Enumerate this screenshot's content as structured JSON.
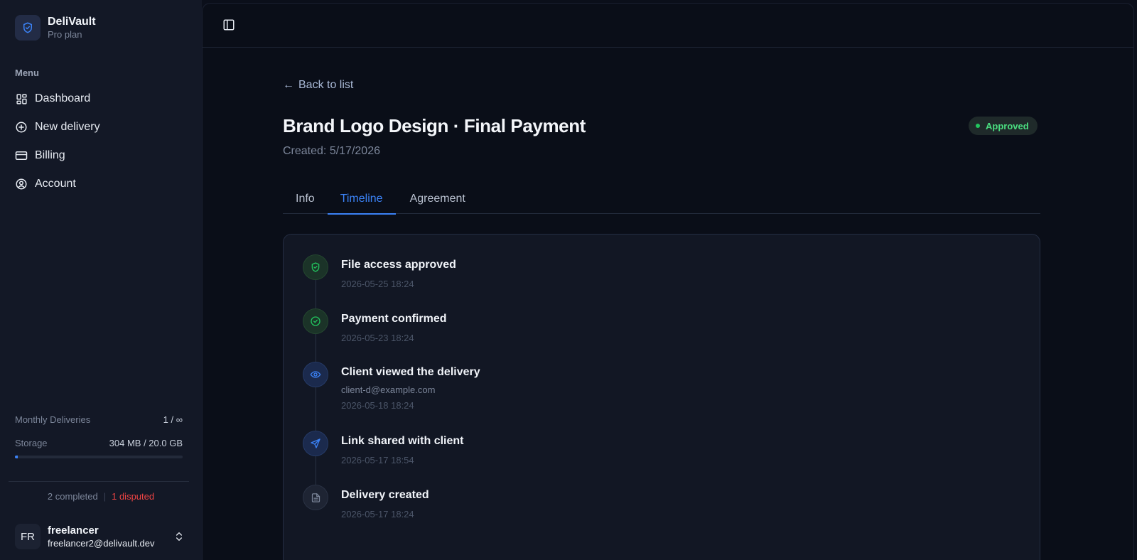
{
  "brand": {
    "name": "DeliVault",
    "plan": "Pro plan",
    "logo_icon": "shield-icon"
  },
  "sidebar": {
    "menu_label": "Menu",
    "items": [
      {
        "label": "Dashboard",
        "icon": "dashboard-icon"
      },
      {
        "label": "New delivery",
        "icon": "plus-circle-icon"
      },
      {
        "label": "Billing",
        "icon": "credit-card-icon"
      },
      {
        "label": "Account",
        "icon": "user-circle-icon"
      }
    ],
    "usage": {
      "monthly_label": "Monthly Deliveries",
      "monthly_value": "1 / ∞",
      "storage_label": "Storage",
      "storage_value": "304 MB / 20.0 GB",
      "storage_fraction": 0.015
    },
    "stats": {
      "completed": "2 completed",
      "separator": "|",
      "disputed": "1 disputed"
    },
    "user": {
      "initials": "FR",
      "name": "freelancer",
      "email": "freelancer2@delivault.dev"
    }
  },
  "header": {
    "toggle_icon": "sidebar-toggle-icon"
  },
  "page": {
    "back_label": "Back to list",
    "back_arrow": "←",
    "title": "Brand Logo Design · Final Payment",
    "created": "Created: 5/17/2026",
    "status": "Approved"
  },
  "tabs": [
    {
      "label": "Info"
    },
    {
      "label": "Timeline",
      "active": true
    },
    {
      "label": "Agreement"
    }
  ],
  "timeline": [
    {
      "title": "File access approved",
      "time": "2026-05-25 18:24",
      "icon": "shield-check-icon",
      "tone": "green"
    },
    {
      "title": "Payment confirmed",
      "time": "2026-05-23 18:24",
      "icon": "check-circle-icon",
      "tone": "green"
    },
    {
      "title": "Client viewed the delivery",
      "detail": "client-d@example.com",
      "time": "2026-05-18 18:24",
      "icon": "eye-icon",
      "tone": "blue"
    },
    {
      "title": "Link shared with client",
      "time": "2026-05-17 18:54",
      "icon": "send-icon",
      "tone": "blue"
    },
    {
      "title": "Delivery created",
      "time": "2026-05-17 18:24",
      "icon": "file-icon",
      "tone": "gray"
    }
  ],
  "colors": {
    "accent": "#3b82f6",
    "success": "#22c55e",
    "danger": "#ef4444"
  }
}
